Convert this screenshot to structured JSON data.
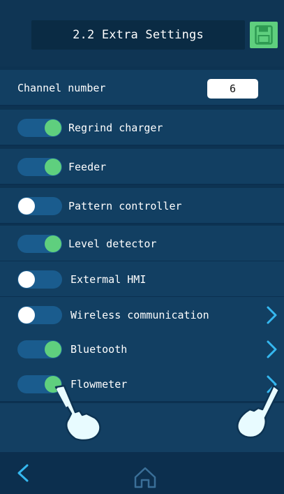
{
  "header": {
    "title": "2.2 Extra Settings",
    "save_icon": "floppy-disk-icon"
  },
  "channel": {
    "label": "Channel number",
    "value": "6"
  },
  "settings": [
    {
      "label": "Regrind charger",
      "enabled": true,
      "has_arrow": false
    },
    {
      "label": "Feeder",
      "enabled": true,
      "has_arrow": false
    },
    {
      "label": "Pattern controller",
      "enabled": false,
      "has_arrow": false
    },
    {
      "label": "Level detector",
      "enabled": true,
      "has_arrow": false
    },
    {
      "label": "Extermal HMI",
      "enabled": false,
      "has_arrow": false
    },
    {
      "label": "Wireless communication",
      "enabled": false,
      "has_arrow": true
    },
    {
      "label": "Bluetooth",
      "enabled": true,
      "has_arrow": true
    },
    {
      "label": "Flowmeter",
      "enabled": true,
      "has_arrow": true
    }
  ],
  "footer": {
    "back_icon": "chevron-left-icon",
    "home_icon": "home-icon"
  },
  "colors": {
    "background": "#0d3352",
    "row": "#123f62",
    "toggle_track": "#1a5c8e",
    "toggle_on": "#5fcf7e",
    "toggle_off": "#ffffff",
    "accent": "#35b8f0"
  }
}
